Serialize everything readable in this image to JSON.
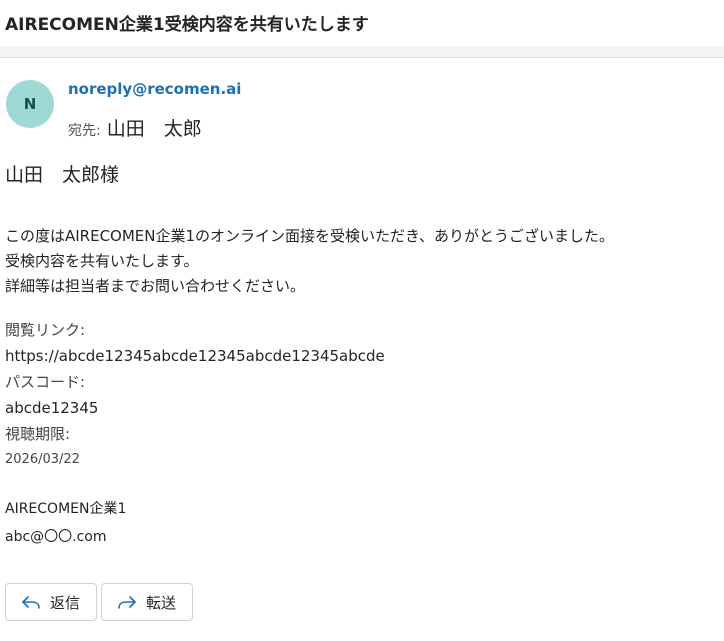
{
  "subject": "AIRECOMEN企業1受検内容を共有いたします",
  "sender": {
    "avatar_initial": "N",
    "email": "noreply@recomen.ai",
    "to_label": "宛先:",
    "to_name": "山田　太郎"
  },
  "body": {
    "greeting": "山田　太郎様",
    "lines": [
      "この度はAIRECOMEN企業1のオンライン面接を受検いただき、ありがとうございました。",
      "受検内容を共有いたします。",
      "詳細等は担当者までお問い合わせください。"
    ],
    "link_label": "閲覧リンク:",
    "link_value": "https://abcde12345abcde12345abcde12345abcde",
    "passcode_label": "パスコード:",
    "passcode_value": "abcde12345",
    "deadline_label": "視聴期限:",
    "deadline_value": "2026/03/22",
    "signature_company": "AIRECOMEN企業1",
    "signature_email": "abc@〇〇.com"
  },
  "actions": {
    "reply_label": "返信",
    "reply_icon": "reply-arrow-icon",
    "forward_label": "転送",
    "forward_icon": "forward-arrow-icon"
  },
  "colors": {
    "sender_link": "#1f6fb5",
    "avatar_bg": "#9fd9d6",
    "icon_blue": "#1f6fb5"
  }
}
